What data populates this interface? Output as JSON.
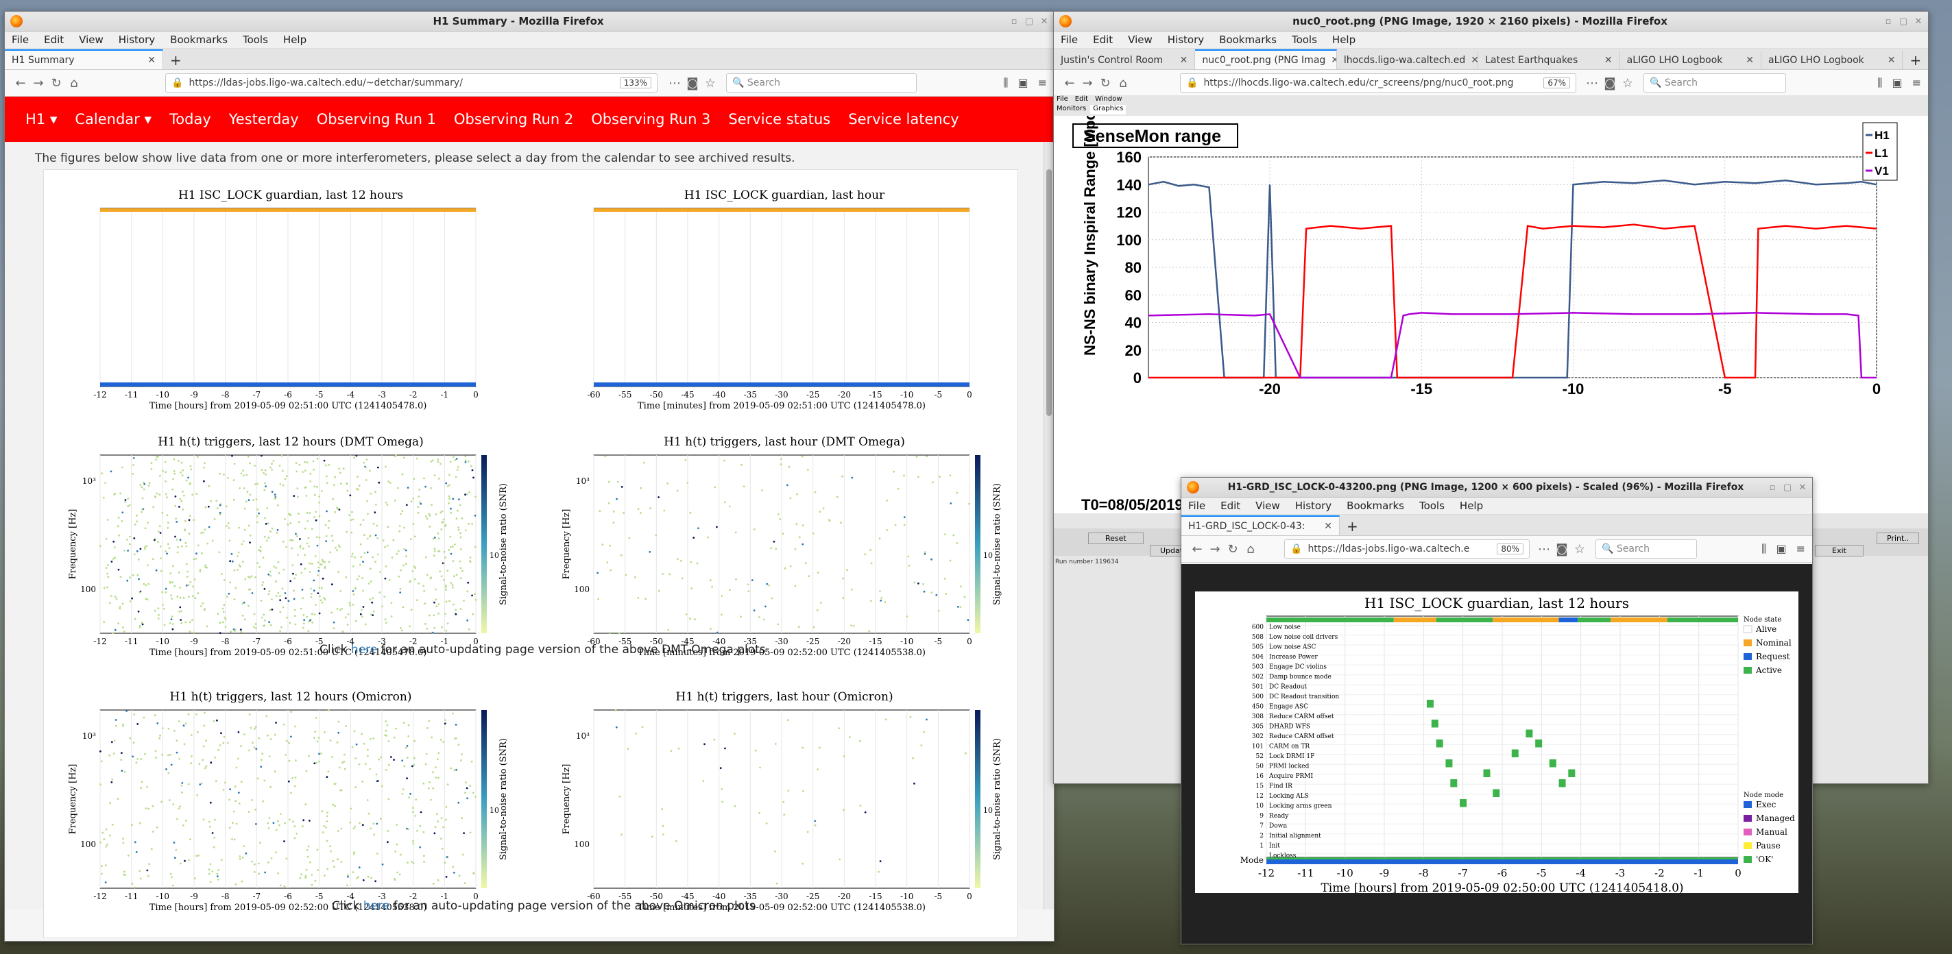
{
  "left_window": {
    "title": "H1 Summary - Mozilla Firefox",
    "menu": [
      "File",
      "Edit",
      "View",
      "History",
      "Bookmarks",
      "Tools",
      "Help"
    ],
    "tab": "H1 Summary",
    "url": "https://ldas-jobs.ligo-wa.caltech.edu/~detchar/summary/",
    "zoom": "133%",
    "search_placeholder": "Search",
    "nav": [
      "H1 ▾",
      "Calendar ▾",
      "Today",
      "Yesterday",
      "Observing Run 1",
      "Observing Run 2",
      "Observing Run 3",
      "Service status",
      "Service latency"
    ],
    "intro": "The figures below show live data from one or more interferometers, please select a day from the calendar to see archived results.",
    "caption1_pre": "Click ",
    "caption1_link": "here",
    "caption1_post": " for an auto-updating page version of the above DMT-Omega plots",
    "caption2_pre": "Click ",
    "caption2_link": "here",
    "caption2_post": " for an auto-updating page version of the above Omicron plots",
    "plots": [
      {
        "title": "H1 ISC_LOCK guardian, last 12 hours",
        "xlabel": "Time [hours] from 2019-05-09 02:51:00 UTC (1241405478.0)",
        "ticks": [
          "-12",
          "-11",
          "-10",
          "-9",
          "-8",
          "-7",
          "-6",
          "-5",
          "-4",
          "-3",
          "-2",
          "-1",
          "0"
        ]
      },
      {
        "title": "H1 ISC_LOCK guardian, last hour",
        "xlabel": "Time [minutes] from 2019-05-09 02:51:00 UTC (1241405478.0)",
        "ticks": [
          "-60",
          "-55",
          "-50",
          "-45",
          "-40",
          "-35",
          "-30",
          "-25",
          "-20",
          "-15",
          "-10",
          "-5",
          "0"
        ]
      },
      {
        "title": "H1 h(t) triggers, last 12 hours (DMT Omega)",
        "xlabel": "Time [hours] from 2019-05-09 02:51:00 UTC (1241405478.0)",
        "ylabel": "Frequency [Hz]",
        "cbar": "Signal-to-noise ratio (SNR)",
        "ticks": [
          "-12",
          "-11",
          "-10",
          "-9",
          "-8",
          "-7",
          "-6",
          "-5",
          "-4",
          "-3",
          "-2",
          "-1",
          "0"
        ]
      },
      {
        "title": "H1 h(t) triggers, last hour (DMT Omega)",
        "xlabel": "Time [minutes] from 2019-05-09 02:52:00 UTC (1241405538.0)",
        "ylabel": "Frequency [Hz]",
        "cbar": "Signal-to-noise ratio (SNR)",
        "ticks": [
          "-60",
          "-55",
          "-50",
          "-45",
          "-40",
          "-35",
          "-30",
          "-25",
          "-20",
          "-15",
          "-10",
          "-5",
          "0"
        ]
      },
      {
        "title": "H1 h(t) triggers, last 12 hours (Omicron)",
        "xlabel": "Time [hours] from 2019-05-09 02:52:00 UTC (1241405538.0)",
        "ylabel": "Frequency [Hz]",
        "cbar": "Signal-to-noise ratio (SNR)",
        "ticks": [
          "-12",
          "-11",
          "-10",
          "-9",
          "-8",
          "-7",
          "-6",
          "-5",
          "-4",
          "-3",
          "-2",
          "-1",
          "0"
        ]
      },
      {
        "title": "H1 h(t) triggers, last hour (Omicron)",
        "xlabel": "Time [minutes] from 2019-05-09 02:52:00 UTC (1241405538.0)",
        "ylabel": "Frequency [Hz]",
        "cbar": "Signal-to-noise ratio (SNR)",
        "ticks": [
          "-60",
          "-55",
          "-50",
          "-45",
          "-40",
          "-35",
          "-30",
          "-25",
          "-20",
          "-15",
          "-10",
          "-5",
          "0"
        ]
      }
    ]
  },
  "right_window": {
    "title": "nuc0_root.png (PNG Image, 1920 × 2160 pixels) - Mozilla Firefox",
    "menu": [
      "File",
      "Edit",
      "View",
      "History",
      "Bookmarks",
      "Tools",
      "Help"
    ],
    "tabs": [
      "Justin's Control Room",
      "nuc0_root.png (PNG Imag",
      "lhocds.ligo-wa.caltech.ed",
      "Latest Earthquakes",
      "aLIGO LHO Logbook",
      "aLIGO LHO Logbook"
    ],
    "url": "https://lhocds.ligo-wa.caltech.edu/cr_screens/png/nuc0_root.png",
    "zoom": "67%",
    "search_placeholder": "Search",
    "app_menu": [
      "File",
      "Edit",
      "Window"
    ],
    "app_tabs": [
      "Monitors",
      "Graphics"
    ],
    "chart_title": "SenseMon range",
    "ylabel": "NS-NS binary Inspiral Range [Mpc]",
    "t0": "T0=08/05/2019",
    "legend": [
      "H1",
      "L1",
      "V1"
    ],
    "buttons": [
      "Reset",
      "Update",
      "Exit",
      "Print.."
    ],
    "status": "Run number 119634"
  },
  "popup_window": {
    "title": "H1-GRD_ISC_LOCK-0-43200.png (PNG Image, 1200 × 600 pixels) - Scaled (96%) - Mozilla Firefox",
    "menu": [
      "File",
      "Edit",
      "View",
      "History",
      "Bookmarks",
      "Tools",
      "Help"
    ],
    "tab": "H1-GRD_ISC_LOCK-0-43:",
    "url": "https://ldas-jobs.ligo-wa.caltech.e",
    "zoom": "80%",
    "search_placeholder": "Search",
    "plot_title": "H1 ISC_LOCK guardian, last 12 hours",
    "xlabel": "Time [hours] from 2019-05-09 02:50:00 UTC (1241405418.0)",
    "xticks": [
      "-12",
      "-11",
      "-10",
      "-9",
      "-8",
      "-7",
      "-6",
      "-5",
      "-4",
      "-3",
      "-2",
      "-1",
      "0"
    ],
    "states": [
      "600",
      "508",
      "505",
      "504",
      "503",
      "502",
      "501",
      "500",
      "450",
      "308",
      "305",
      "302",
      "101",
      "52",
      "50",
      "16",
      "15",
      "12",
      "10",
      "9",
      "7",
      "2",
      "1"
    ],
    "state_names": [
      "Low noise",
      "Low noise coil drivers",
      "Low noise ASC",
      "Increase Power",
      "Engage DC violins",
      "Damp bounce mode",
      "DC Readout",
      "DC Readout transition",
      "Engage ASC",
      "Reduce CARM offset",
      "DHARD WFS",
      "Reduce CARM offset",
      "CARM on TR",
      "Lock DRMI 1F",
      "PRMI locked",
      "Acquire PRMI",
      "Find IR",
      "Locking ALS",
      "Locking arms green",
      "Ready",
      "Down",
      "Initial alignment",
      "Init",
      "Lockloss"
    ],
    "node_state_title": "Node state",
    "node_state": [
      "Alive",
      "Nominal",
      "Request",
      "Active"
    ],
    "node_mode_title": "Node mode",
    "node_mode": [
      "Exec",
      "Managed",
      "Manual",
      "Pause",
      "'OK'"
    ],
    "mode_label": "Mode",
    "colors": {
      "nominal": "#f5a623",
      "request": "#1e64d8",
      "active": "#3cb44b",
      "managed": "#7b1fa2",
      "manual": "#e060c0",
      "pause": "#ffee33"
    }
  },
  "chart_data": {
    "type": "line",
    "title": "SenseMon range",
    "xlabel": "",
    "ylabel": "NS-NS binary Inspiral Range [Mpc]",
    "xlim": [
      -24,
      0
    ],
    "ylim": [
      0,
      160
    ],
    "xticks": [
      -20,
      -15,
      -10,
      -5,
      0
    ],
    "yticks": [
      0,
      20,
      40,
      60,
      80,
      100,
      120,
      140,
      160
    ],
    "series": [
      {
        "name": "H1",
        "color": "#3a5a8c",
        "x": [
          -24,
          -23.5,
          -23,
          -22.5,
          -22,
          -21.5,
          -21,
          -20.2,
          -20,
          -19.8,
          -19.5,
          -19,
          -18,
          -17,
          -16,
          -15,
          -14,
          -13,
          -12,
          -11,
          -10.2,
          -10,
          -9,
          -8,
          -7,
          -6,
          -5,
          -4,
          -3,
          -2,
          -1,
          -0.5,
          0
        ],
        "values": [
          140,
          142,
          139,
          140,
          138,
          0,
          0,
          0,
          140,
          0,
          0,
          0,
          0,
          0,
          0,
          0,
          0,
          0,
          0,
          0,
          0,
          140,
          142,
          141,
          143,
          140,
          142,
          141,
          143,
          140,
          141,
          142,
          140
        ]
      },
      {
        "name": "L1",
        "color": "#ff0000",
        "x": [
          -24,
          -20,
          -19,
          -18.8,
          -18,
          -17,
          -16,
          -15.8,
          -15,
          -14.5,
          -13,
          -12,
          -11.5,
          -11,
          -10,
          -9,
          -8,
          -7,
          -6,
          -5,
          -4,
          -3.9,
          -3,
          -2,
          -1,
          -0.5,
          0
        ],
        "values": [
          0,
          0,
          0,
          108,
          110,
          108,
          110,
          0,
          0,
          0,
          0,
          0,
          110,
          108,
          110,
          109,
          111,
          108,
          110,
          0,
          0,
          108,
          110,
          108,
          110,
          109,
          108
        ]
      },
      {
        "name": "V1",
        "color": "#b000d8",
        "x": [
          -24,
          -22,
          -20.5,
          -20,
          -19,
          -18,
          -17,
          -16,
          -15.6,
          -15.4,
          -15,
          -14,
          -12,
          -10,
          -8,
          -6,
          -4,
          -2,
          -1,
          -0.6,
          -0.5,
          0
        ],
        "values": [
          45,
          46,
          45,
          46,
          0,
          0,
          0,
          0,
          45,
          46,
          47,
          46,
          46,
          47,
          46,
          46,
          47,
          46,
          46,
          45,
          0,
          0
        ]
      }
    ]
  }
}
